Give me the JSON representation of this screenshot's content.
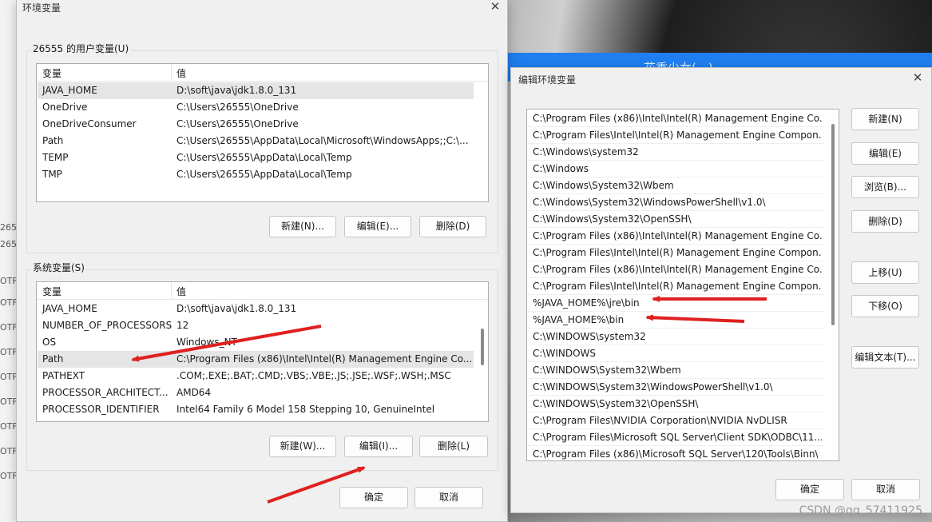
{
  "background": {
    "left_fragments": [
      "265",
      "265",
      "OTF",
      "OTF",
      "OTF",
      "OTF",
      "OTF",
      "OTF",
      "OTF",
      "OTF",
      "OTF"
    ],
    "right_banner_text": "花季少女(…)"
  },
  "env_dialog": {
    "title": "环境变量",
    "user_group_label": "26555 的用户变量(U)",
    "system_group_label": "系统变量(S)",
    "col_variable": "变量",
    "col_value": "值",
    "user_vars": [
      {
        "name": "JAVA_HOME",
        "value": "D:\\soft\\java\\jdk1.8.0_131"
      },
      {
        "name": "OneDrive",
        "value": "C:\\Users\\26555\\OneDrive"
      },
      {
        "name": "OneDriveConsumer",
        "value": "C:\\Users\\26555\\OneDrive"
      },
      {
        "name": "Path",
        "value": "C:\\Users\\26555\\AppData\\Local\\Microsoft\\WindowsApps;;C:\\..."
      },
      {
        "name": "TEMP",
        "value": "C:\\Users\\26555\\AppData\\Local\\Temp"
      },
      {
        "name": "TMP",
        "value": "C:\\Users\\26555\\AppData\\Local\\Temp"
      }
    ],
    "system_vars": [
      {
        "name": "JAVA_HOME",
        "value": "D:\\soft\\java\\jdk1.8.0_131"
      },
      {
        "name": "NUMBER_OF_PROCESSORS",
        "value": "12"
      },
      {
        "name": "OS",
        "value": "Windows_NT"
      },
      {
        "name": "Path",
        "value": "C:\\Program Files (x86)\\Intel\\Intel(R) Management Engine Co..."
      },
      {
        "name": "PATHEXT",
        "value": ".COM;.EXE;.BAT;.CMD;.VBS;.VBE;.JS;.JSE;.WSF;.WSH;.MSC"
      },
      {
        "name": "PROCESSOR_ARCHITECT...",
        "value": "AMD64"
      },
      {
        "name": "PROCESSOR_IDENTIFIER",
        "value": "Intel64 Family 6 Model 158 Stepping 10, GenuineIntel"
      }
    ],
    "user_buttons": {
      "new": "新建(N)...",
      "edit": "编辑(E)...",
      "delete": "删除(D)"
    },
    "system_buttons": {
      "new": "新建(W)...",
      "edit": "编辑(I)...",
      "delete": "删除(L)"
    },
    "ok": "确定",
    "cancel": "取消"
  },
  "edit_dialog": {
    "title": "编辑环境变量",
    "entries": [
      "C:\\Program Files (x86)\\Intel\\Intel(R) Management Engine Co...",
      "C:\\Program Files\\Intel\\Intel(R) Management Engine Compon...",
      "C:\\Windows\\system32",
      "C:\\Windows",
      "C:\\Windows\\System32\\Wbem",
      "C:\\Windows\\System32\\WindowsPowerShell\\v1.0\\",
      "C:\\Windows\\System32\\OpenSSH\\",
      "C:\\Program Files (x86)\\Intel\\Intel(R) Management Engine Co...",
      "C:\\Program Files\\Intel\\Intel(R) Management Engine Compon...",
      "C:\\Program Files (x86)\\Intel\\Intel(R) Management Engine Co...",
      "C:\\Program Files\\Intel\\Intel(R) Management Engine Compon...",
      "%JAVA_HOME%\\jre\\bin",
      "%JAVA_HOME%\\bin",
      "C:\\WINDOWS\\system32",
      "C:\\WINDOWS",
      "C:\\WINDOWS\\System32\\Wbem",
      "C:\\WINDOWS\\System32\\WindowsPowerShell\\v1.0\\",
      "C:\\WINDOWS\\System32\\OpenSSH\\",
      "C:\\Program Files\\NVIDIA Corporation\\NVIDIA NvDLISR",
      "C:\\Program Files\\Microsoft SQL Server\\Client SDK\\ODBC\\11...",
      "C:\\Program Files (x86)\\Microsoft SQL Server\\120\\Tools\\Binn\\"
    ],
    "buttons": {
      "new": "新建(N)",
      "edit": "编辑(E)",
      "browse": "浏览(B)...",
      "delete": "删除(D)",
      "move_up": "上移(U)",
      "move_down": "下移(O)",
      "edit_text": "编辑文本(T)...",
      "ok": "确定",
      "cancel": "取消"
    }
  },
  "watermark": "CSDN @qq_57411925",
  "annotation_color": "#e02020"
}
